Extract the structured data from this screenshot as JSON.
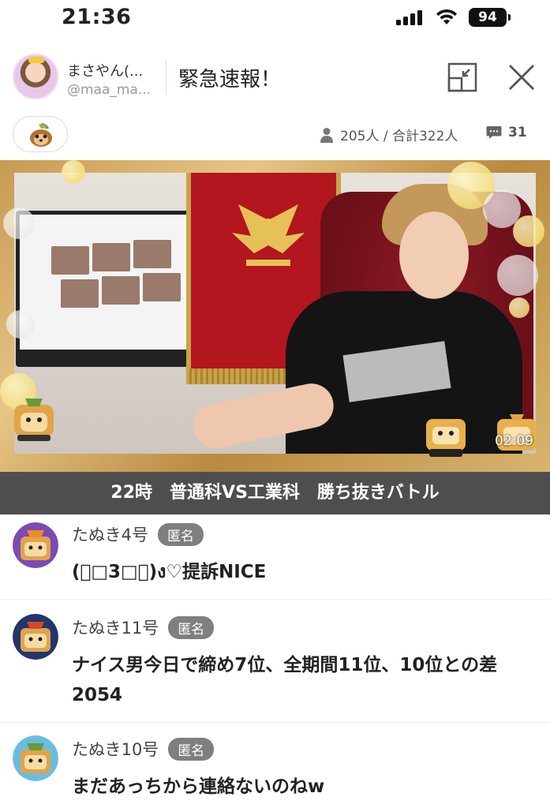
{
  "status_bar": {
    "time": "21:36",
    "battery": "94"
  },
  "header": {
    "user_name": "まさやん(...",
    "user_handle": "@maa_ma...",
    "title": "緊急速報！"
  },
  "info": {
    "viewers": "205人 / 合計322人",
    "comment_count": "31"
  },
  "video": {
    "timer": "02:09"
  },
  "caption": "22時　普通科VS工業科　勝ち抜きバトル",
  "comments": [
    {
      "name": "たぬき4号",
      "badge": "匿名",
      "text": "(ﾟ□3□ﾟ)ง♡提訴NICE",
      "accent": "#7b4bb3"
    },
    {
      "name": "たぬき11号",
      "badge": "匿名",
      "text": "ナイス男今日で締め7位、全期間11位、10位との差2054",
      "accent": "#23356b"
    },
    {
      "name": "たぬき10号",
      "badge": "匿名",
      "text": "まだあっちから連絡ないのねw",
      "accent": "#6bbde0"
    }
  ],
  "colors": {
    "caption_bg": "#4e4e4e",
    "badge_bg": "#7f7f7f",
    "frame_gold": "#c79a52"
  },
  "icons": {
    "minimize": "minimize-icon",
    "close": "close-icon",
    "item": "tanuki-item-icon",
    "viewers": "person-icon",
    "comments": "chat-bubble-icon"
  }
}
